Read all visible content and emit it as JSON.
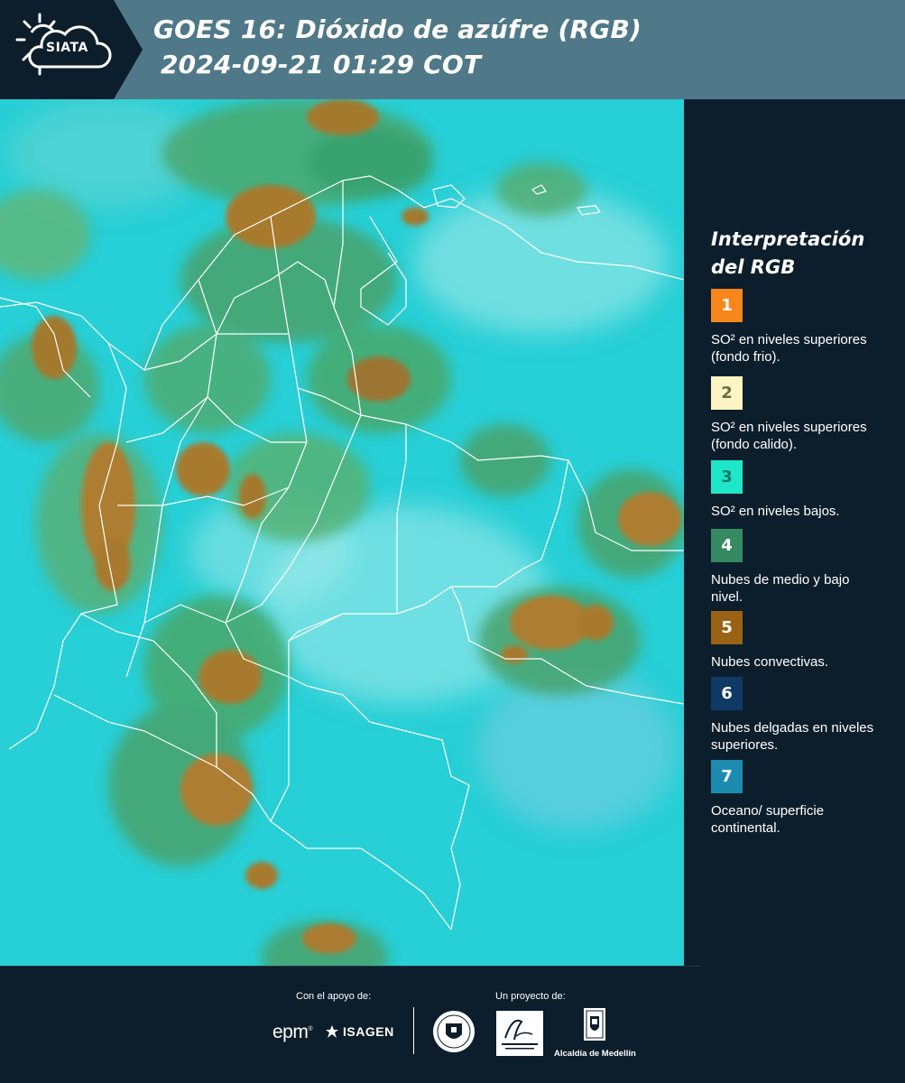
{
  "header": {
    "logo_text": "SIATA",
    "title_line1": "GOES 16: Dióxido de azúfre (RGB)",
    "title_line2": "2024-09-21 01:29 COT",
    "background_color": "#4f7888",
    "logo_panel_color": "#0c1e2c"
  },
  "map": {
    "base_color": "#27cfd6",
    "region": "Colombia y alrededores",
    "content": [
      "continental outlines",
      "cloud layers",
      "convective cloud cells"
    ]
  },
  "legend": {
    "title": "Interpretación del RGB",
    "items": [
      {
        "number": "1",
        "color": "#f7861b",
        "text_color": "#ffffff",
        "label": "SO² en niveles superiores (fondo frio)."
      },
      {
        "number": "2",
        "color": "#fdf4c3",
        "text_color": "#6b6b3f",
        "label": "SO² en niveles superiores (fondo calido)."
      },
      {
        "number": "3",
        "color": "#1ee7c7",
        "text_color": "#0f7a6a",
        "label": "SO² en niveles bajos."
      },
      {
        "number": "4",
        "color": "#358a62",
        "text_color": "#ffffff",
        "label": "Nubes de medio y bajo nivel."
      },
      {
        "number": "5",
        "color": "#9a6214",
        "text_color": "#ffffff",
        "label": "Nubes convectivas."
      },
      {
        "number": "6",
        "color": "#0f3a66",
        "text_color": "#ffffff",
        "label": "Nubes delgadas en niveles superiores."
      },
      {
        "number": "7",
        "color": "#1d8bb0",
        "text_color": "#ffffff",
        "label": "Oceano/ superficie continental."
      }
    ]
  },
  "footer": {
    "support_caption": "Con el apoyo de:",
    "project_caption": "Un proyecto de:",
    "epm_logo": "epm",
    "isagen_logo": "ISAGEN",
    "amva_logo": "Área Metropolitana Valle de Aburrá",
    "alcaldia_logo": "Alcaldía de Medellín"
  }
}
